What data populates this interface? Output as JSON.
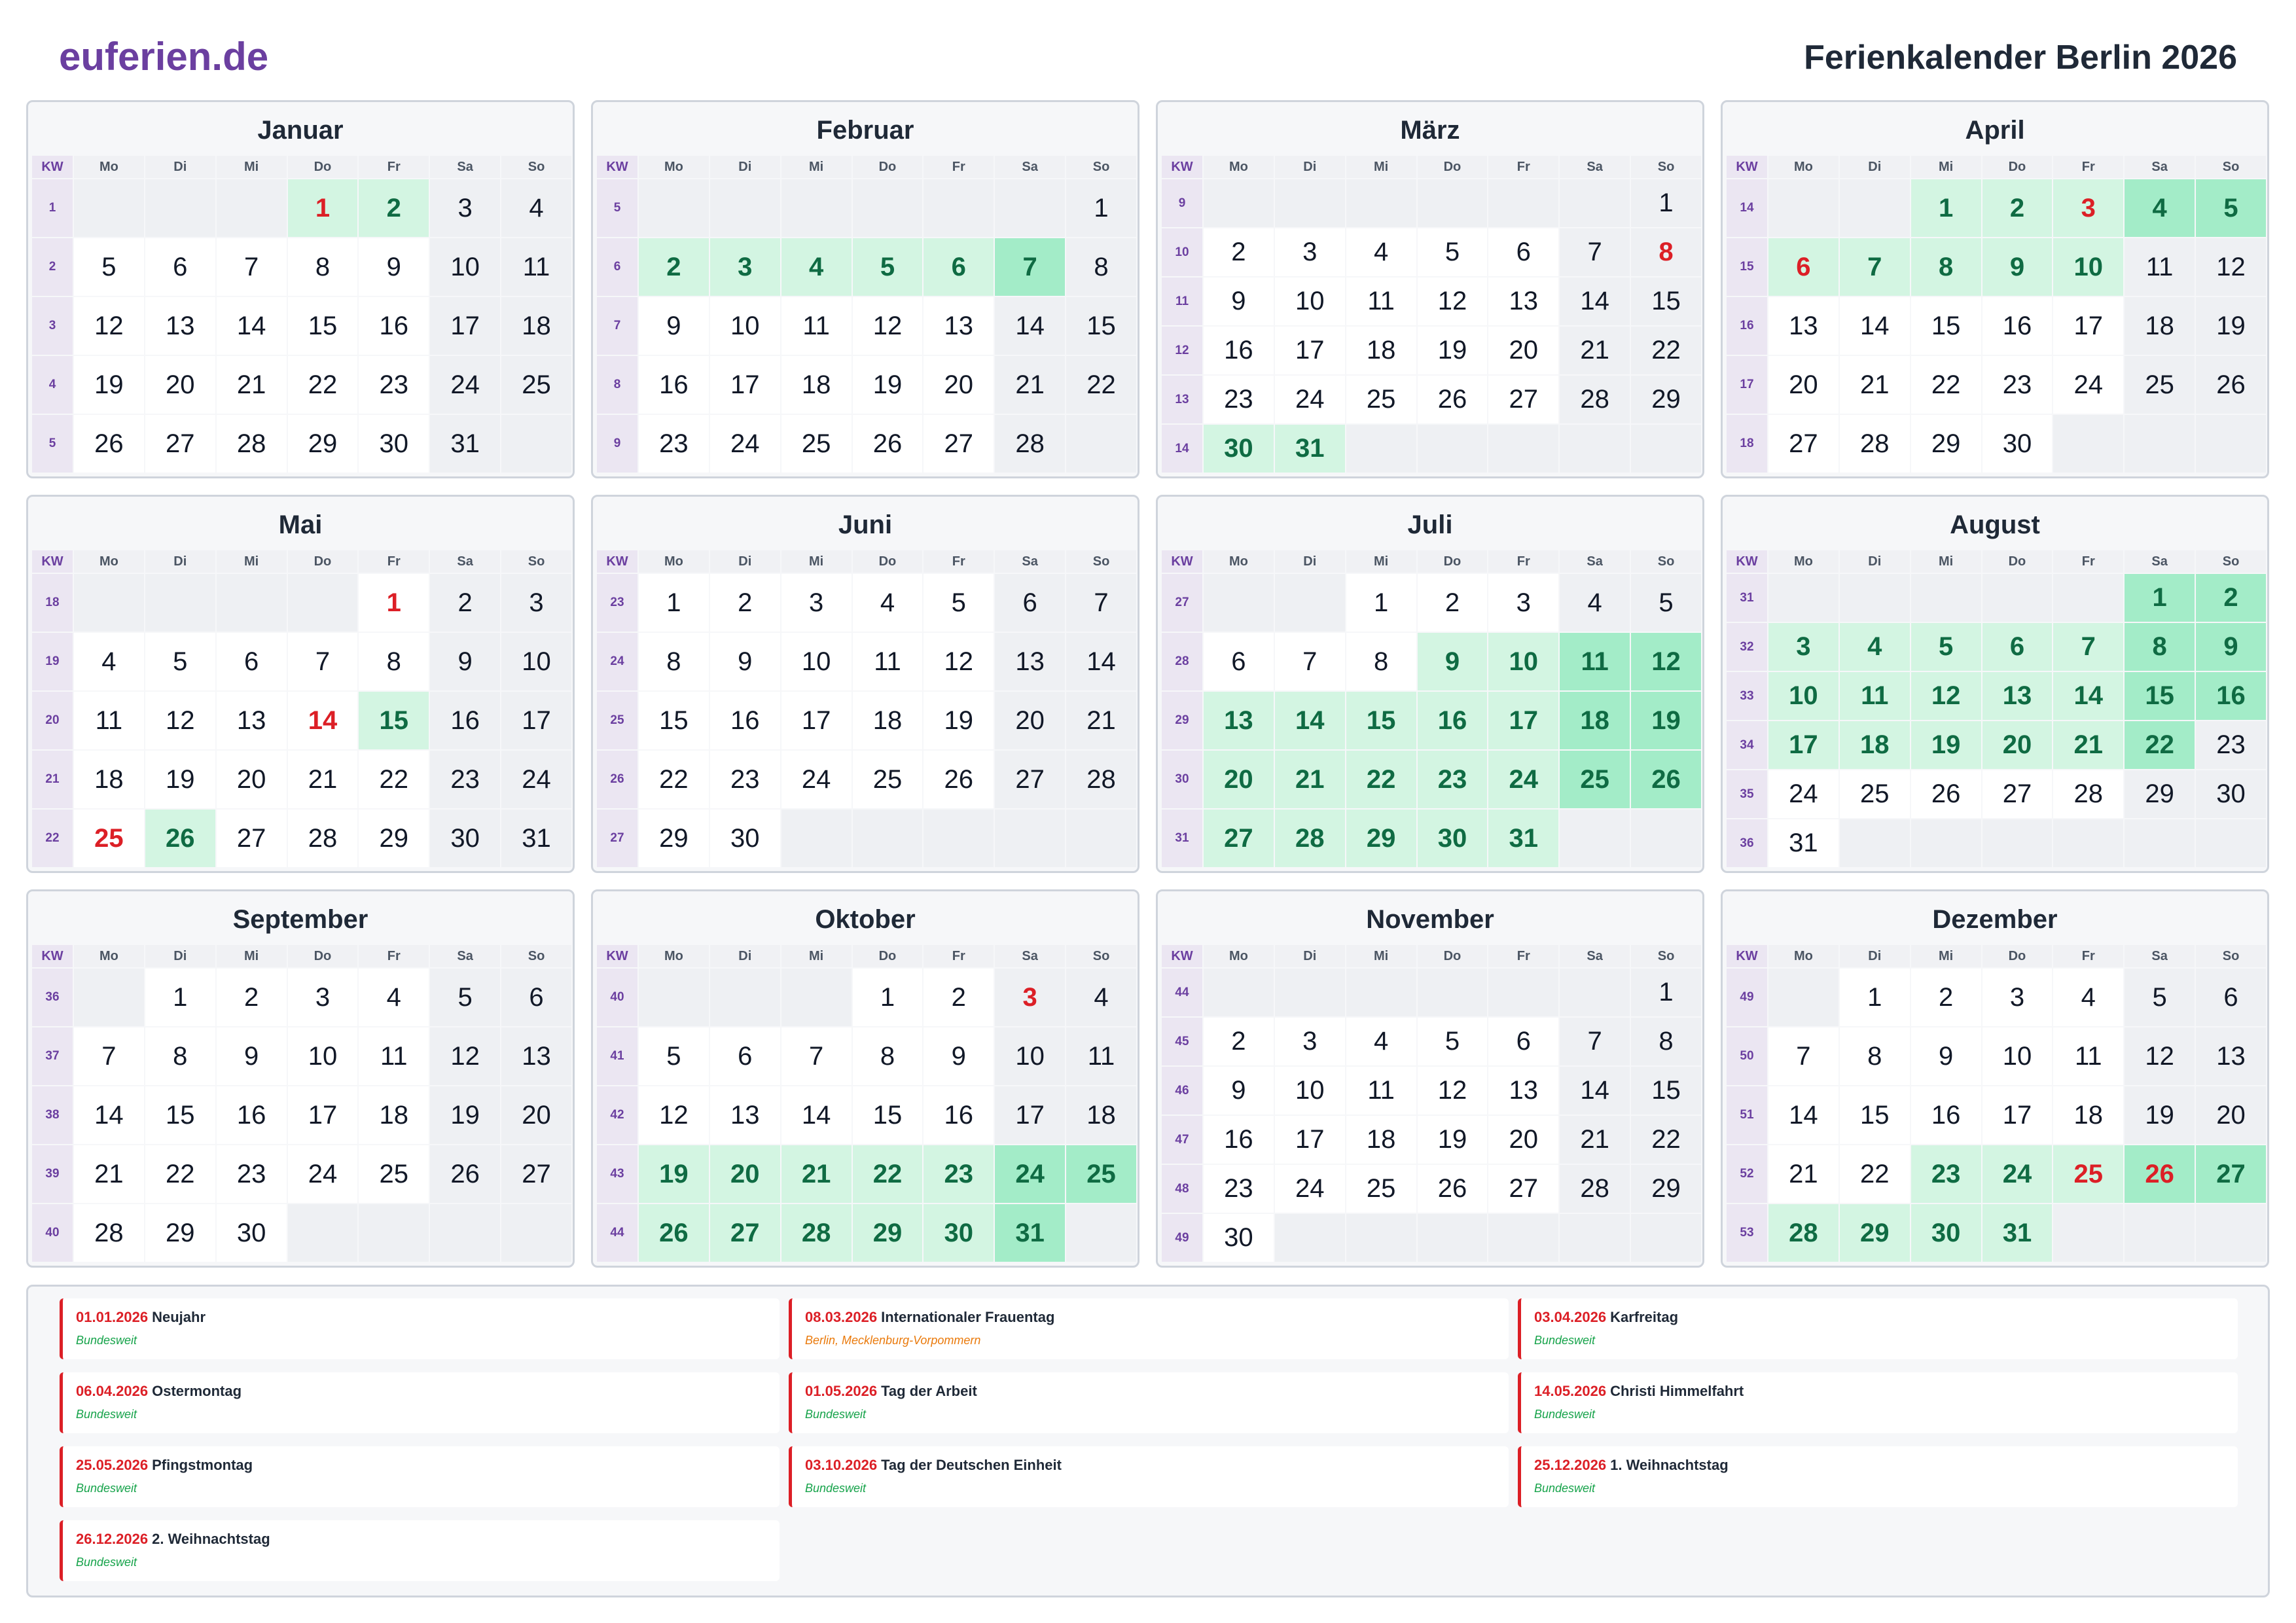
{
  "brand": "euferien.de",
  "title": "Ferienkalender Berlin 2026",
  "weekday_header": [
    "KW",
    "Mo",
    "Di",
    "Mi",
    "Do",
    "Fr",
    "Sa",
    "So"
  ],
  "colors": {
    "brand": "#6b3fa0",
    "holiday_fill": "#d3f5e2",
    "holiday_weekend_fill": "#a3ecc8",
    "public_holiday_text": "#dc1f26"
  },
  "months": [
    {
      "name": "Januar",
      "weeks": [
        [
          1,
          null,
          null,
          null,
          1,
          2,
          3,
          4
        ],
        [
          2,
          5,
          6,
          7,
          8,
          9,
          10,
          11
        ],
        [
          3,
          12,
          13,
          14,
          15,
          16,
          17,
          18
        ],
        [
          4,
          19,
          20,
          21,
          22,
          23,
          24,
          25
        ],
        [
          5,
          26,
          27,
          28,
          29,
          30,
          31,
          null
        ]
      ],
      "holidays": [
        1,
        2
      ],
      "public": [
        1
      ]
    },
    {
      "name": "Februar",
      "weeks": [
        [
          5,
          null,
          null,
          null,
          null,
          null,
          null,
          1
        ],
        [
          6,
          2,
          3,
          4,
          5,
          6,
          7,
          8
        ],
        [
          7,
          9,
          10,
          11,
          12,
          13,
          14,
          15
        ],
        [
          8,
          16,
          17,
          18,
          19,
          20,
          21,
          22
        ],
        [
          9,
          23,
          24,
          25,
          26,
          27,
          28,
          null
        ]
      ],
      "holidays": [
        2,
        3,
        4,
        5,
        6,
        7
      ],
      "public": []
    },
    {
      "name": "März",
      "weeks": [
        [
          9,
          null,
          null,
          null,
          null,
          null,
          null,
          1
        ],
        [
          10,
          2,
          3,
          4,
          5,
          6,
          7,
          8
        ],
        [
          11,
          9,
          10,
          11,
          12,
          13,
          14,
          15
        ],
        [
          12,
          16,
          17,
          18,
          19,
          20,
          21,
          22
        ],
        [
          13,
          23,
          24,
          25,
          26,
          27,
          28,
          29
        ],
        [
          14,
          30,
          31,
          null,
          null,
          null,
          null,
          null
        ]
      ],
      "holidays": [
        30,
        31
      ],
      "public": [
        8
      ]
    },
    {
      "name": "April",
      "weeks": [
        [
          14,
          null,
          null,
          1,
          2,
          3,
          4,
          5
        ],
        [
          15,
          6,
          7,
          8,
          9,
          10,
          11,
          12
        ],
        [
          16,
          13,
          14,
          15,
          16,
          17,
          18,
          19
        ],
        [
          17,
          20,
          21,
          22,
          23,
          24,
          25,
          26
        ],
        [
          18,
          27,
          28,
          29,
          30,
          null,
          null,
          null
        ]
      ],
      "holidays": [
        1,
        2,
        3,
        4,
        5,
        6,
        7,
        8,
        9,
        10
      ],
      "public": [
        3,
        6
      ]
    },
    {
      "name": "Mai",
      "weeks": [
        [
          18,
          null,
          null,
          null,
          null,
          1,
          2,
          3
        ],
        [
          19,
          4,
          5,
          6,
          7,
          8,
          9,
          10
        ],
        [
          20,
          11,
          12,
          13,
          14,
          15,
          16,
          17
        ],
        [
          21,
          18,
          19,
          20,
          21,
          22,
          23,
          24
        ],
        [
          22,
          25,
          26,
          27,
          28,
          29,
          30,
          31
        ]
      ],
      "holidays": [
        15,
        26
      ],
      "public": [
        1,
        14,
        25
      ]
    },
    {
      "name": "Juni",
      "weeks": [
        [
          23,
          1,
          2,
          3,
          4,
          5,
          6,
          7
        ],
        [
          24,
          8,
          9,
          10,
          11,
          12,
          13,
          14
        ],
        [
          25,
          15,
          16,
          17,
          18,
          19,
          20,
          21
        ],
        [
          26,
          22,
          23,
          24,
          25,
          26,
          27,
          28
        ],
        [
          27,
          29,
          30,
          null,
          null,
          null,
          null,
          null
        ]
      ],
      "holidays": [],
      "public": []
    },
    {
      "name": "Juli",
      "weeks": [
        [
          27,
          null,
          null,
          1,
          2,
          3,
          4,
          5
        ],
        [
          28,
          6,
          7,
          8,
          9,
          10,
          11,
          12
        ],
        [
          29,
          13,
          14,
          15,
          16,
          17,
          18,
          19
        ],
        [
          30,
          20,
          21,
          22,
          23,
          24,
          25,
          26
        ],
        [
          31,
          27,
          28,
          29,
          30,
          31,
          null,
          null
        ]
      ],
      "holidays": [
        9,
        10,
        11,
        12,
        13,
        14,
        15,
        16,
        17,
        18,
        19,
        20,
        21,
        22,
        23,
        24,
        25,
        26,
        27,
        28,
        29,
        30,
        31
      ],
      "public": []
    },
    {
      "name": "August",
      "weeks": [
        [
          31,
          null,
          null,
          null,
          null,
          null,
          1,
          2
        ],
        [
          32,
          3,
          4,
          5,
          6,
          7,
          8,
          9
        ],
        [
          33,
          10,
          11,
          12,
          13,
          14,
          15,
          16
        ],
        [
          34,
          17,
          18,
          19,
          20,
          21,
          22,
          23
        ],
        [
          35,
          24,
          25,
          26,
          27,
          28,
          29,
          30
        ],
        [
          36,
          31,
          null,
          null,
          null,
          null,
          null,
          null
        ]
      ],
      "holidays": [
        1,
        2,
        3,
        4,
        5,
        6,
        7,
        8,
        9,
        10,
        11,
        12,
        13,
        14,
        15,
        16,
        17,
        18,
        19,
        20,
        21,
        22
      ],
      "public": []
    },
    {
      "name": "September",
      "weeks": [
        [
          36,
          null,
          1,
          2,
          3,
          4,
          5,
          6
        ],
        [
          37,
          7,
          8,
          9,
          10,
          11,
          12,
          13
        ],
        [
          38,
          14,
          15,
          16,
          17,
          18,
          19,
          20
        ],
        [
          39,
          21,
          22,
          23,
          24,
          25,
          26,
          27
        ],
        [
          40,
          28,
          29,
          30,
          null,
          null,
          null,
          null
        ]
      ],
      "holidays": [],
      "public": []
    },
    {
      "name": "Oktober",
      "weeks": [
        [
          40,
          null,
          null,
          null,
          1,
          2,
          3,
          4
        ],
        [
          41,
          5,
          6,
          7,
          8,
          9,
          10,
          11
        ],
        [
          42,
          12,
          13,
          14,
          15,
          16,
          17,
          18
        ],
        [
          43,
          19,
          20,
          21,
          22,
          23,
          24,
          25
        ],
        [
          44,
          26,
          27,
          28,
          29,
          30,
          31,
          null
        ]
      ],
      "holidays": [
        19,
        20,
        21,
        22,
        23,
        24,
        25,
        26,
        27,
        28,
        29,
        30,
        31
      ],
      "public": [
        3
      ]
    },
    {
      "name": "November",
      "weeks": [
        [
          44,
          null,
          null,
          null,
          null,
          null,
          null,
          1
        ],
        [
          45,
          2,
          3,
          4,
          5,
          6,
          7,
          8
        ],
        [
          46,
          9,
          10,
          11,
          12,
          13,
          14,
          15
        ],
        [
          47,
          16,
          17,
          18,
          19,
          20,
          21,
          22
        ],
        [
          48,
          23,
          24,
          25,
          26,
          27,
          28,
          29
        ],
        [
          49,
          30,
          null,
          null,
          null,
          null,
          null,
          null
        ]
      ],
      "holidays": [],
      "public": []
    },
    {
      "name": "Dezember",
      "weeks": [
        [
          49,
          null,
          1,
          2,
          3,
          4,
          5,
          6
        ],
        [
          50,
          7,
          8,
          9,
          10,
          11,
          12,
          13
        ],
        [
          51,
          14,
          15,
          16,
          17,
          18,
          19,
          20
        ],
        [
          52,
          21,
          22,
          23,
          24,
          25,
          26,
          27
        ],
        [
          53,
          28,
          29,
          30,
          31,
          null,
          null,
          null
        ]
      ],
      "holidays": [
        23,
        24,
        25,
        26,
        27,
        28,
        29,
        30,
        31
      ],
      "public": [
        25,
        26
      ]
    }
  ],
  "public_holidays": [
    {
      "date": "01.01.2026",
      "name": "Neujahr",
      "region": "Bundesweit",
      "partial": false
    },
    {
      "date": "08.03.2026",
      "name": "Internationaler Frauentag",
      "region": "Berlin, Mecklenburg-Vorpommern",
      "partial": true
    },
    {
      "date": "03.04.2026",
      "name": "Karfreitag",
      "region": "Bundesweit",
      "partial": false
    },
    {
      "date": "06.04.2026",
      "name": "Ostermontag",
      "region": "Bundesweit",
      "partial": false
    },
    {
      "date": "01.05.2026",
      "name": "Tag der Arbeit",
      "region": "Bundesweit",
      "partial": false
    },
    {
      "date": "14.05.2026",
      "name": "Christi Himmelfahrt",
      "region": "Bundesweit",
      "partial": false
    },
    {
      "date": "25.05.2026",
      "name": "Pfingstmontag",
      "region": "Bundesweit",
      "partial": false
    },
    {
      "date": "03.10.2026",
      "name": "Tag der Deutschen Einheit",
      "region": "Bundesweit",
      "partial": false
    },
    {
      "date": "25.12.2026",
      "name": "1. Weihnachtstag",
      "region": "Bundesweit",
      "partial": false
    },
    {
      "date": "26.12.2026",
      "name": "2. Weihnachtstag",
      "region": "Bundesweit",
      "partial": false
    }
  ]
}
